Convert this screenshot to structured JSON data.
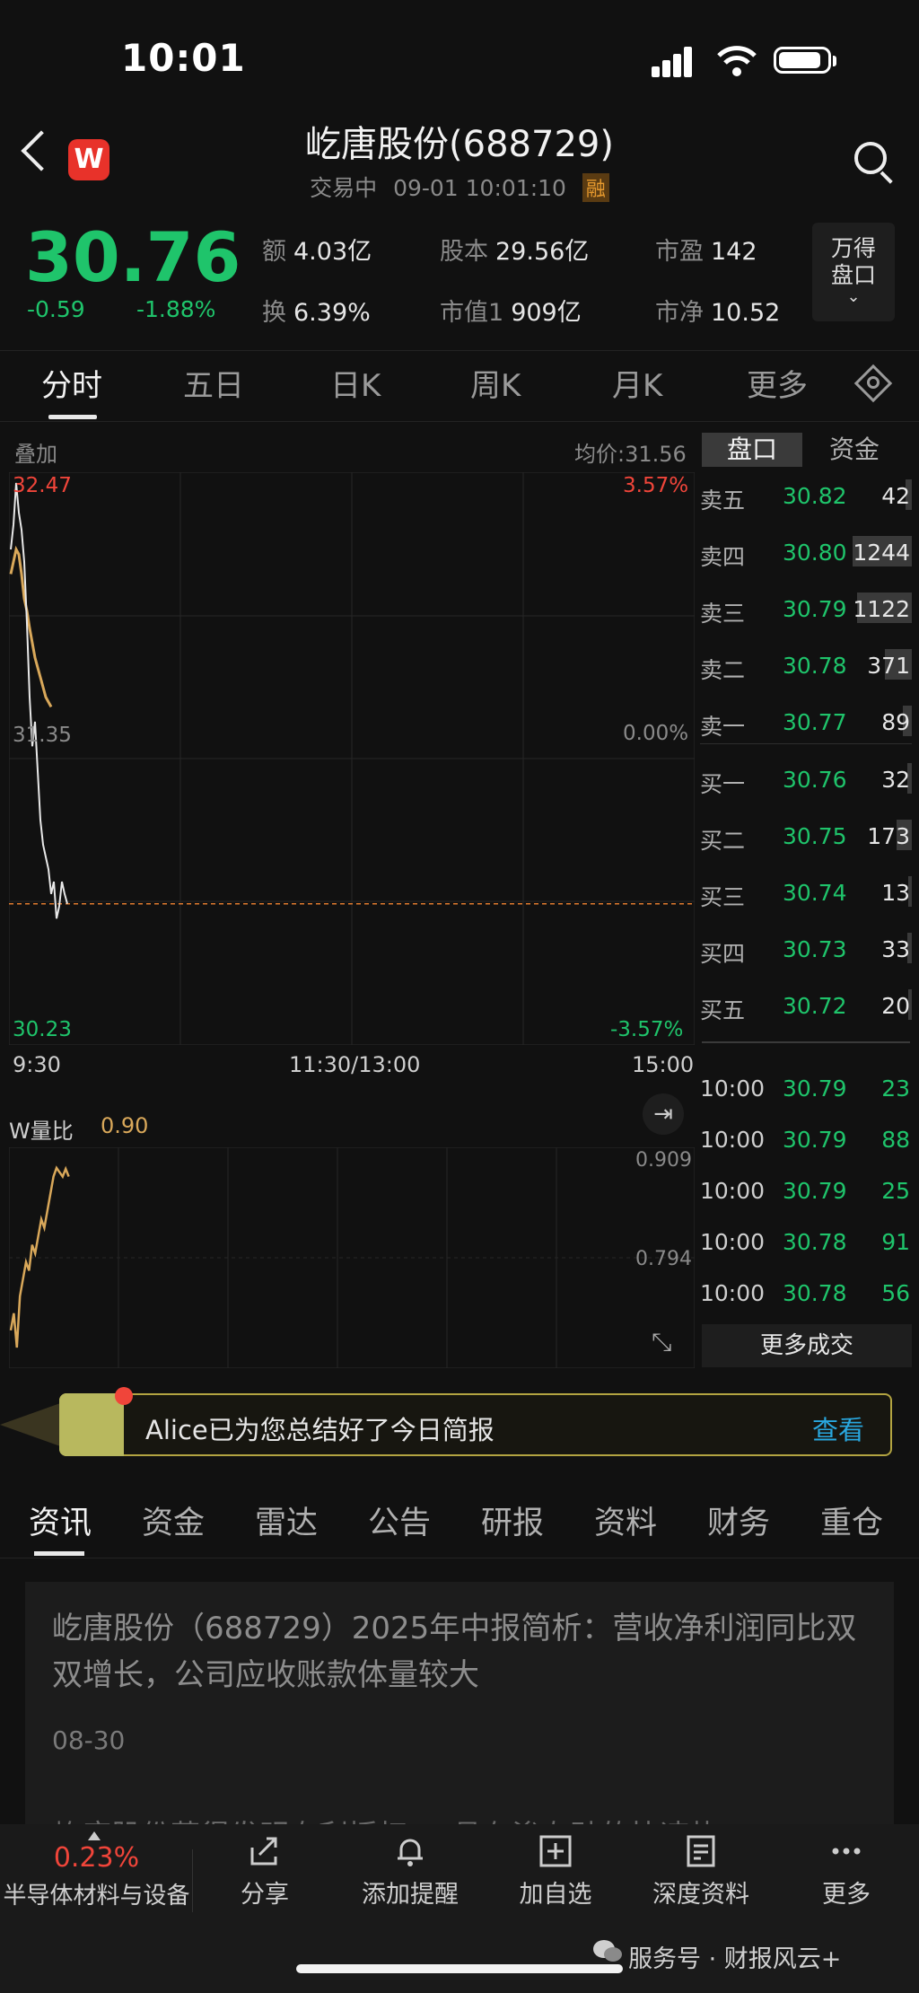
{
  "status_bar": {
    "time": "10:01"
  },
  "header": {
    "title": "屹唐股份(688729)",
    "status": "交易中",
    "datetime": "09-01 10:01:10",
    "margin_badge": "融"
  },
  "quote": {
    "price": "30.76",
    "change": "-0.59",
    "change_pct": "-1.88%",
    "stats": [
      {
        "key": "额",
        "value": "4.03亿"
      },
      {
        "key": "股本",
        "value": "29.56亿"
      },
      {
        "key": "市盈",
        "value": "142"
      },
      {
        "key": "换",
        "value": "6.39%"
      },
      {
        "key": "市值1",
        "value": "909亿"
      },
      {
        "key": "市净",
        "value": "10.52"
      }
    ],
    "wande_button": [
      "万得",
      "盘口"
    ]
  },
  "chart_tabs": [
    "分时",
    "五日",
    "日K",
    "周K",
    "月K",
    "更多"
  ],
  "chart": {
    "overlay_label": "叠加",
    "avg_price_label": "均价:31.56",
    "y_high": "32.47",
    "y_mid": "31.35",
    "y_low": "30.23",
    "pct_high": "3.57%",
    "pct_mid": "0.00%",
    "pct_low": "-3.57%",
    "x_start": "9:30",
    "x_mid": "11:30/13:00",
    "x_end": "15:00",
    "volume_ratio_label": "W量比",
    "volume_ratio_value": "0.90",
    "vr_top": "0.909",
    "vr_mid": "0.794"
  },
  "chart_data": {
    "type": "line",
    "price_series": [
      32.2,
      32.3,
      32.47,
      32.35,
      32.28,
      32.15,
      31.9,
      31.6,
      31.4,
      31.5,
      31.3,
      31.1,
      31.0,
      30.95,
      30.9,
      30.8,
      30.85,
      30.7,
      30.75,
      30.85,
      30.8,
      30.76
    ],
    "avg_series": [
      32.1,
      32.15,
      32.2,
      32.18,
      32.1,
      32.0,
      31.95,
      31.88,
      31.82,
      31.76,
      31.72,
      31.68,
      31.64,
      31.6,
      31.58,
      31.56
    ],
    "ylim": [
      30.23,
      32.47
    ],
    "prev_close": 31.35,
    "current_price": 30.76,
    "volume_ratio_series": [
      0.72,
      0.74,
      0.7,
      0.76,
      0.78,
      0.8,
      0.79,
      0.82,
      0.81,
      0.83,
      0.85,
      0.84,
      0.86,
      0.88,
      0.9,
      0.91,
      0.905,
      0.9,
      0.909,
      0.9
    ],
    "vr_ylim": [
      0.68,
      0.93
    ]
  },
  "order_book": {
    "tabs": [
      "盘口",
      "资金"
    ],
    "asks": [
      {
        "label": "卖五",
        "price": "30.82",
        "volume": "42",
        "bar": 0.1
      },
      {
        "label": "卖四",
        "price": "30.80",
        "volume": "1244",
        "bar": 1.0
      },
      {
        "label": "卖三",
        "price": "30.79",
        "volume": "1122",
        "bar": 0.92
      },
      {
        "label": "卖二",
        "price": "30.78",
        "volume": "371",
        "bar": 0.45
      },
      {
        "label": "卖一",
        "price": "30.77",
        "volume": "89",
        "bar": 0.15
      }
    ],
    "bids": [
      {
        "label": "买一",
        "price": "30.76",
        "volume": "32",
        "bar": 0.08
      },
      {
        "label": "买二",
        "price": "30.75",
        "volume": "173",
        "bar": 0.25
      },
      {
        "label": "买三",
        "price": "30.74",
        "volume": "13",
        "bar": 0.06
      },
      {
        "label": "买四",
        "price": "30.73",
        "volume": "33",
        "bar": 0.08
      },
      {
        "label": "买五",
        "price": "30.72",
        "volume": "20",
        "bar": 0.06
      }
    ],
    "ticks": [
      {
        "time": "10:00",
        "price": "30.79",
        "volume": "23"
      },
      {
        "time": "10:00",
        "price": "30.79",
        "volume": "88"
      },
      {
        "time": "10:00",
        "price": "30.79",
        "volume": "25"
      },
      {
        "time": "10:00",
        "price": "30.78",
        "volume": "91"
      },
      {
        "time": "10:00",
        "price": "30.78",
        "volume": "56"
      }
    ],
    "more_trades": "更多成交"
  },
  "banner": {
    "text": "Alice已为您总结好了今日简报",
    "action": "查看"
  },
  "news_tabs": [
    "资讯",
    "资金",
    "雷达",
    "公告",
    "研报",
    "资料",
    "财务",
    "重仓"
  ],
  "news": {
    "title": "屹唐股份（688729）2025年中报简析：营收净利润同比双双增长，公司应收账款体量较大",
    "date": "08-30",
    "next_preview": "屹唐股份获得发明专利授权：“具有渗杂硅的快速热"
  },
  "bottom_bar": {
    "sector_change": "0.23%",
    "sector_name": "半导体材料与设备",
    "items": [
      "分享",
      "添加提醒",
      "加自选",
      "深度资料",
      "更多"
    ]
  },
  "watermark": "服务号 · 财报风云+"
}
